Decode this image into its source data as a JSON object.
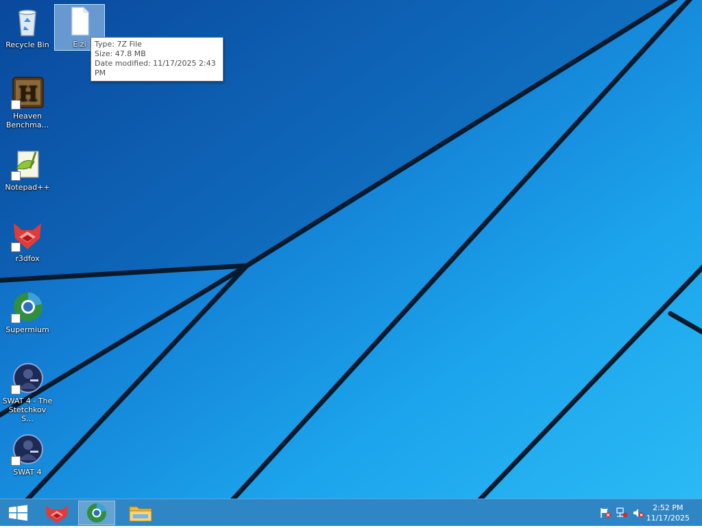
{
  "desktop": {
    "icons": [
      {
        "label": "Recycle Bin",
        "icon": "recycle-bin-icon"
      },
      {
        "label": "E.zi",
        "icon": "file-icon",
        "selected": true
      },
      {
        "label": "Heaven Benchma...",
        "icon": "heaven-benchmark-icon"
      },
      {
        "label": "Notepad++",
        "icon": "notepadpp-icon"
      },
      {
        "label": "r3dfox",
        "icon": "r3dfox-icon"
      },
      {
        "label": "Supermium",
        "icon": "supermium-icon"
      },
      {
        "label": "SWAT 4 - The Stetchkov S...",
        "icon": "swat4-expansion-icon"
      },
      {
        "label": "SWAT 4",
        "icon": "swat4-icon"
      }
    ]
  },
  "tooltip": {
    "type_line": "Type: 7Z File",
    "size_line": "Size: 47.8 MB",
    "date_line": "Date modified: 11/17/2025 2:43 PM"
  },
  "taskbar": {
    "buttons": [
      {
        "name": "start",
        "icon": "windows-logo-icon"
      },
      {
        "name": "r3dfox",
        "icon": "r3dfox-icon"
      },
      {
        "name": "supermium",
        "icon": "supermium-icon",
        "active": true
      },
      {
        "name": "file-explorer",
        "icon": "folder-icon"
      }
    ],
    "tray": {
      "icons": [
        "action-center-flag-icon",
        "network-icon",
        "volume-muted-icon"
      ],
      "time": "2:52 PM",
      "date": "11/17/2025"
    }
  },
  "colors": {
    "taskbar": "#2f86c4",
    "tooltip_border": "#767676",
    "wallpaper_light": "#2ab8f5",
    "wallpaper_dark": "#0a4fa8"
  }
}
